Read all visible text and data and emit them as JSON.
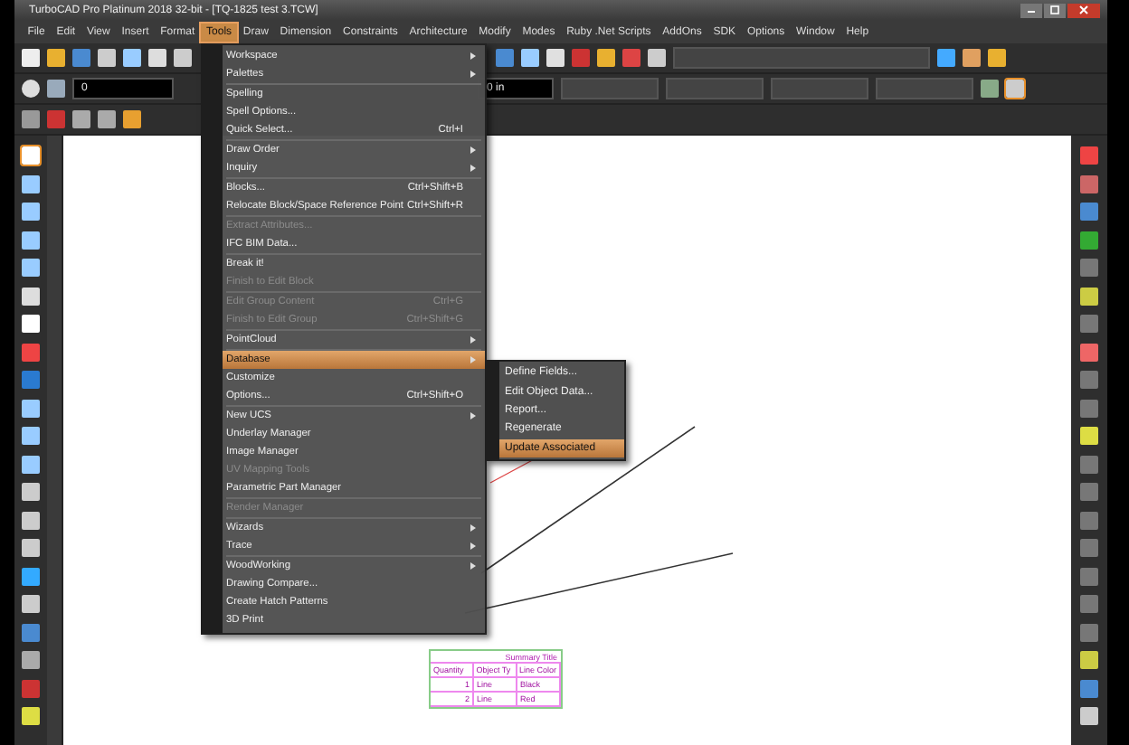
{
  "window": {
    "title": "TurboCAD Pro Platinum 2018 32-bit - [TQ-1825 test 3.TCW]"
  },
  "menu_bar": [
    {
      "label": "File",
      "selected": false
    },
    {
      "label": "Edit",
      "selected": false
    },
    {
      "label": "View",
      "selected": false
    },
    {
      "label": "Insert",
      "selected": false
    },
    {
      "label": "Format",
      "selected": false
    },
    {
      "label": "Tools",
      "selected": true
    },
    {
      "label": "Draw",
      "selected": false
    },
    {
      "label": "Dimension",
      "selected": false
    },
    {
      "label": "Constraints",
      "selected": false
    },
    {
      "label": "Architecture",
      "selected": false
    },
    {
      "label": "Modify",
      "selected": false
    },
    {
      "label": "Modes",
      "selected": false
    },
    {
      "label": "Ruby .Net Scripts",
      "selected": false
    },
    {
      "label": "AddOns",
      "selected": false
    },
    {
      "label": "SDK",
      "selected": false
    },
    {
      "label": "Options",
      "selected": false
    },
    {
      "label": "Window",
      "selected": false
    },
    {
      "label": "Help",
      "selected": false
    }
  ],
  "toolbar": {
    "layer_field": {
      "value": "0"
    },
    "thickness_field": {
      "value": "0 in"
    }
  },
  "tools_menu": {
    "groups": [
      [
        {
          "label": "Workspace",
          "submenu": true,
          "disabled": false,
          "selected": false
        },
        {
          "label": "Palettes",
          "submenu": true,
          "disabled": false,
          "selected": false
        }
      ],
      [
        {
          "label": "Spelling",
          "submenu": false,
          "disabled": false,
          "selected": false
        },
        {
          "label": "Spell Options...",
          "submenu": false,
          "disabled": false,
          "selected": false
        },
        {
          "label": "Quick Select...",
          "shortcut": "Ctrl+I",
          "submenu": false,
          "disabled": false,
          "selected": false
        }
      ],
      [
        {
          "label": "Draw Order",
          "submenu": true,
          "disabled": false,
          "selected": false
        },
        {
          "label": "Inquiry",
          "submenu": true,
          "disabled": false,
          "selected": false
        }
      ],
      [
        {
          "label": "Blocks...",
          "shortcut": "Ctrl+Shift+B",
          "submenu": false,
          "disabled": false,
          "selected": false
        },
        {
          "label": "Relocate Block/Space Reference Point",
          "shortcut": "Ctrl+Shift+R",
          "submenu": false,
          "disabled": false,
          "selected": false
        }
      ],
      [
        {
          "label": "Extract Attributes...",
          "submenu": false,
          "disabled": true,
          "selected": false
        },
        {
          "label": "IFC BIM Data...",
          "submenu": false,
          "disabled": false,
          "selected": false
        }
      ],
      [
        {
          "label": "Break it!",
          "submenu": false,
          "disabled": false,
          "selected": false
        },
        {
          "label": "Finish to Edit Block",
          "submenu": false,
          "disabled": true,
          "selected": false
        }
      ],
      [
        {
          "label": "Edit Group Content",
          "shortcut": "Ctrl+G",
          "submenu": false,
          "disabled": true,
          "selected": false
        },
        {
          "label": "Finish to Edit Group",
          "shortcut": "Ctrl+Shift+G",
          "submenu": false,
          "disabled": true,
          "selected": false
        }
      ],
      [
        {
          "label": "PointCloud",
          "submenu": true,
          "disabled": false,
          "selected": false
        }
      ],
      [
        {
          "label": "Database",
          "submenu": true,
          "disabled": false,
          "selected": true
        },
        {
          "label": "Customize",
          "submenu": false,
          "disabled": false,
          "selected": false
        },
        {
          "label": "Options...",
          "shortcut": "Ctrl+Shift+O",
          "submenu": false,
          "disabled": false,
          "selected": false
        }
      ],
      [
        {
          "label": "New UCS",
          "submenu": true,
          "disabled": false,
          "selected": false
        },
        {
          "label": "Underlay Manager",
          "submenu": false,
          "disabled": false,
          "selected": false
        },
        {
          "label": "Image Manager",
          "submenu": false,
          "disabled": false,
          "selected": false
        },
        {
          "label": "UV Mapping Tools",
          "submenu": false,
          "disabled": true,
          "selected": false
        },
        {
          "label": "Parametric Part Manager",
          "submenu": false,
          "disabled": false,
          "selected": false
        }
      ],
      [
        {
          "label": "Render Manager",
          "submenu": false,
          "disabled": true,
          "selected": false
        }
      ],
      [
        {
          "label": "Wizards",
          "submenu": true,
          "disabled": false,
          "selected": false
        },
        {
          "label": "Trace",
          "submenu": true,
          "disabled": false,
          "selected": false
        }
      ],
      [
        {
          "label": "WoodWorking",
          "submenu": true,
          "disabled": false,
          "selected": false
        },
        {
          "label": "Drawing Compare...",
          "submenu": false,
          "disabled": false,
          "selected": false
        },
        {
          "label": "Create Hatch Patterns",
          "submenu": false,
          "disabled": false,
          "selected": false
        },
        {
          "label": "3D Print",
          "submenu": false,
          "disabled": false,
          "selected": false
        }
      ]
    ]
  },
  "database_submenu": [
    {
      "label": "Define Fields...",
      "selected": false
    },
    {
      "label": "Edit Object Data...",
      "selected": false
    },
    {
      "label": "Report...",
      "selected": false
    },
    {
      "label": "Regenerate",
      "selected": false
    },
    {
      "label": "Update Associated",
      "selected": true
    }
  ],
  "drawing_table": {
    "title": "Summary Title",
    "columns": [
      "Quantity",
      "Object Ty",
      "Line Color"
    ],
    "rows": [
      [
        "1",
        "Line",
        "Black"
      ],
      [
        "2",
        "Line",
        "Red"
      ]
    ]
  }
}
